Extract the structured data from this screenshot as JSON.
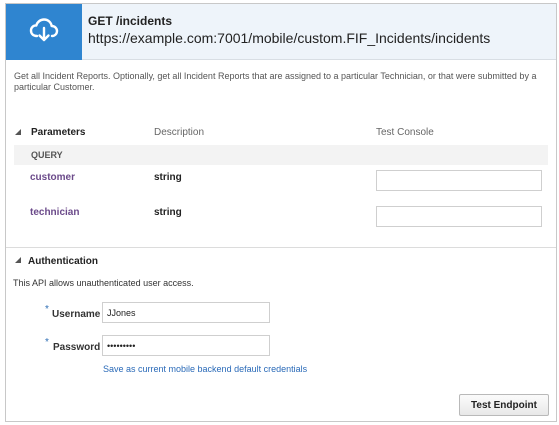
{
  "endpoint": {
    "method_path": "GET /incidents",
    "url": "https://example.com:7001/mobile/custom.FIF_Incidents/incidents",
    "description": "Get all Incident Reports. Optionally, get all Incident Reports that are assigned to a particular Technician, or that were submitted by a particular Customer.",
    "icon": "cloud-download-icon"
  },
  "parameters": {
    "section_label": "Parameters",
    "columns": [
      "Parameters",
      "Description",
      "Test Console"
    ],
    "group_label": "QUERY",
    "items": [
      {
        "name": "customer",
        "type": "string",
        "value": ""
      },
      {
        "name": "technician",
        "type": "string",
        "value": ""
      }
    ]
  },
  "authentication": {
    "section_label": "Authentication",
    "note": "This API allows unauthenticated user access.",
    "required_mark": "*",
    "username_label": "Username",
    "username_value": "JJones",
    "password_label": "Password",
    "password_value": "•••••••••",
    "save_link": "Save as current mobile backend default credentials"
  },
  "actions": {
    "test_button": "Test Endpoint"
  },
  "colors": {
    "accent": "#2f85d0",
    "header_bg": "#eef4fa",
    "param_name": "#6b4a8a",
    "link": "#2a6ab8"
  }
}
